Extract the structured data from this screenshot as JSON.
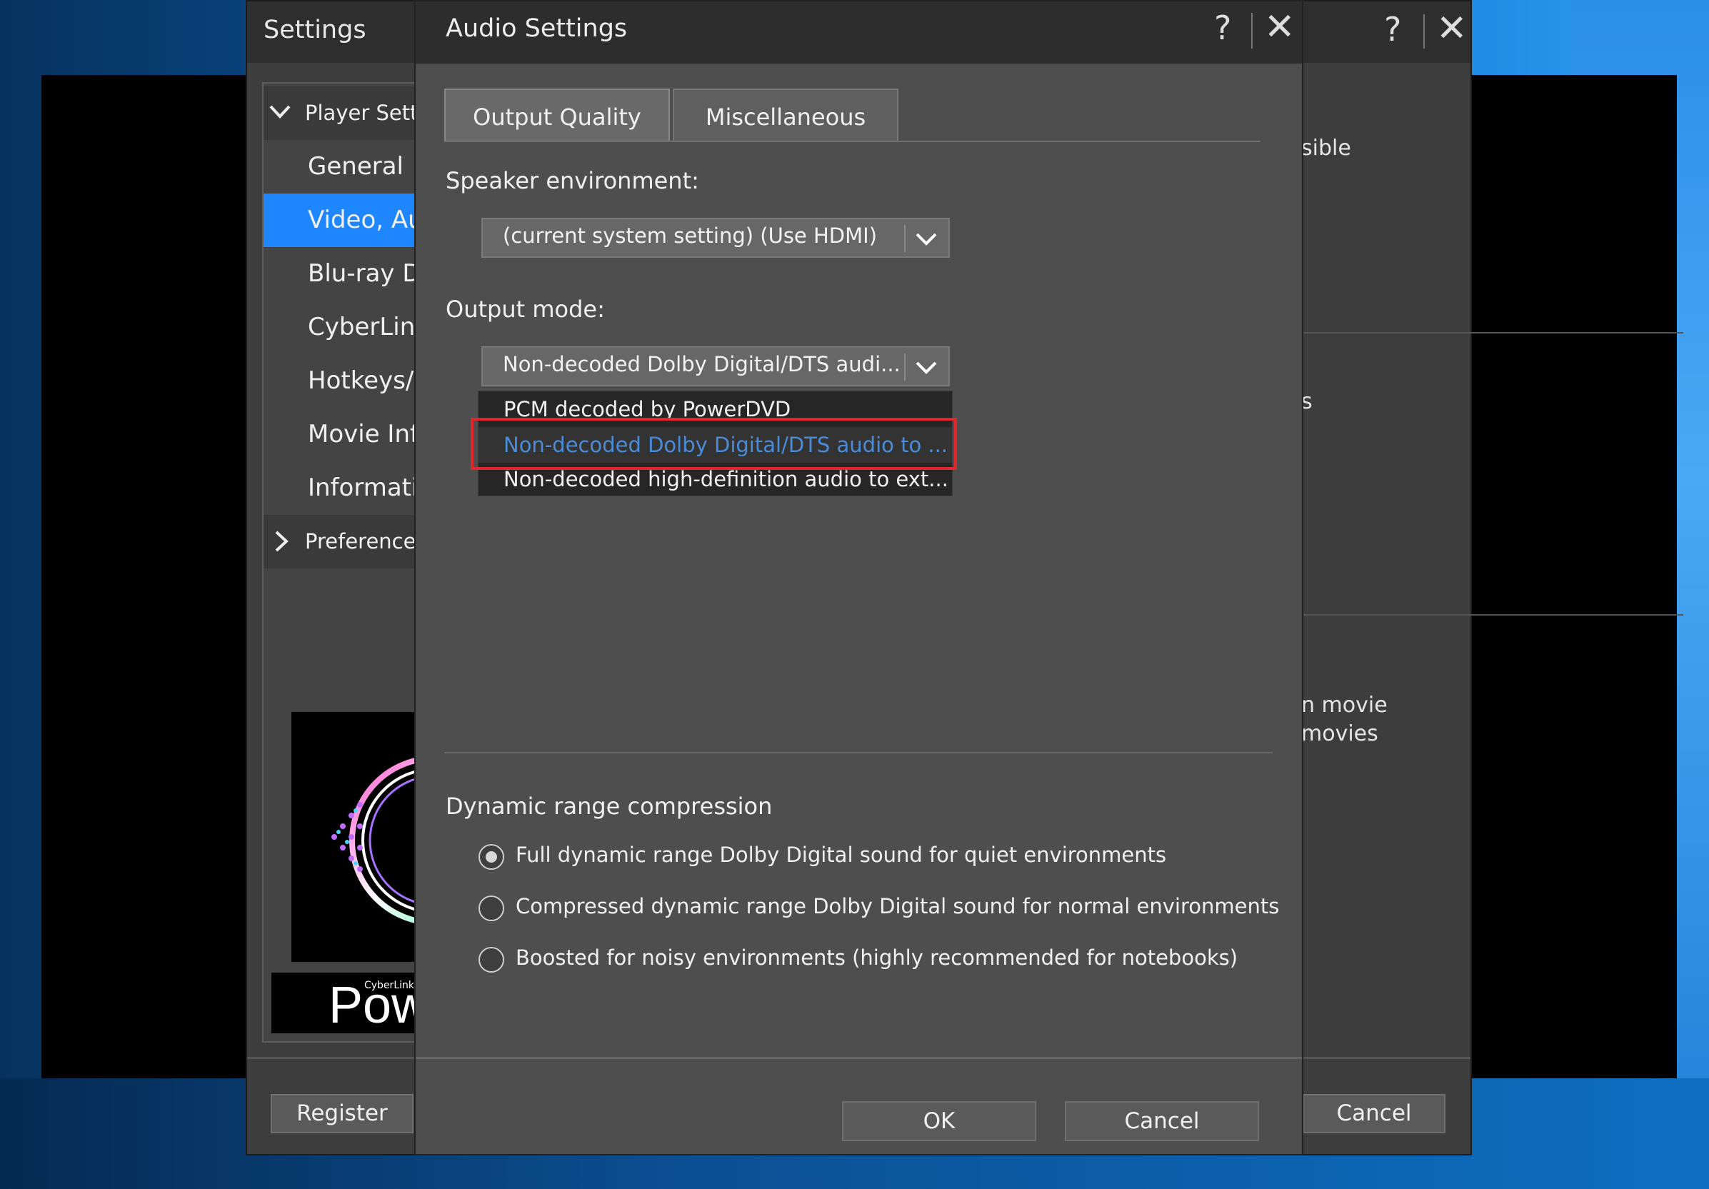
{
  "settings_window": {
    "title": "Settings",
    "help_glyph": "?",
    "close_glyph": "✕",
    "tree": [
      {
        "label": "Player Setti",
        "type": "group-expanded"
      },
      {
        "label": "General"
      },
      {
        "label": "Video, Au",
        "selected": true
      },
      {
        "label": "Blu-ray D"
      },
      {
        "label": "CyberLink"
      },
      {
        "label": "Hotkeys/I"
      },
      {
        "label": "Movie Inf"
      },
      {
        "label": "Informatic"
      },
      {
        "label": "Preferences",
        "type": "group-collapsed"
      }
    ],
    "register_label": "Register",
    "cancel_label": "Cancel",
    "banner_brand": "CyberLink",
    "banner_text": "Pow",
    "right_peek": [
      "sible",
      "s",
      "n movie",
      "movies"
    ]
  },
  "audio_dialog": {
    "title": "Audio Settings",
    "help_glyph": "?",
    "close_glyph": "✕",
    "tabs": [
      {
        "label": "Output Quality",
        "active": true
      },
      {
        "label": "Miscellaneous",
        "active": false
      }
    ],
    "speaker_environment": {
      "label": "Speaker environment:",
      "value": "(current system setting) (Use HDMI)"
    },
    "output_mode": {
      "label": "Output mode:",
      "value": "Non-decoded Dolby Digital/DTS audi...",
      "options": [
        "PCM decoded by PowerDVD",
        "Non-decoded Dolby Digital/DTS audio to ...",
        "Non-decoded high-definition audio to ext..."
      ],
      "highlighted_index": 1
    },
    "drc": {
      "label": "Dynamic range compression",
      "options": [
        {
          "label": "Full dynamic range Dolby Digital sound for quiet environments",
          "checked": true
        },
        {
          "label": "Compressed dynamic range Dolby Digital sound for normal environments",
          "checked": false
        },
        {
          "label": "Boosted for noisy environments (highly recommended for notebooks)",
          "checked": false
        }
      ]
    },
    "ok_label": "OK",
    "cancel_label": "Cancel"
  },
  "colors": {
    "selection": "#1e86ff",
    "highlight_box": "#e3262c",
    "highlighted_option_text": "#4b8cd9"
  }
}
